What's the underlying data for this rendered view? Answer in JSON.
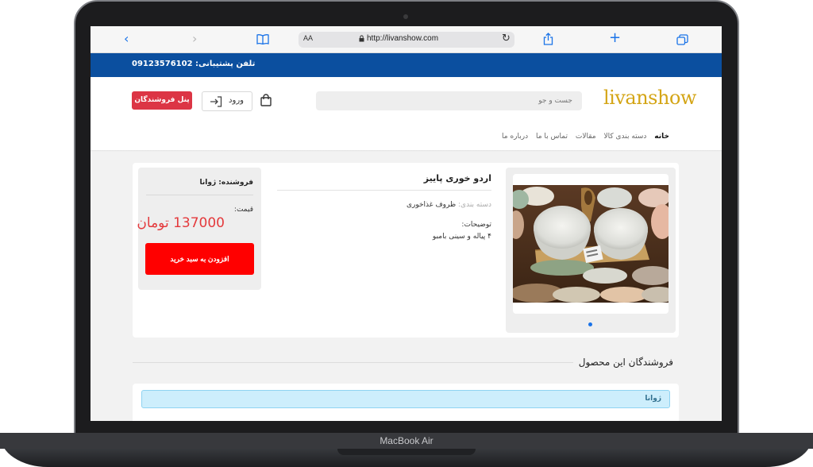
{
  "device": {
    "label": "MacBook Air"
  },
  "browser": {
    "url": "http://livanshow.com",
    "text_size": "AA",
    "icons": [
      "chevron-left-icon",
      "chevron-right-icon",
      "book-icon",
      "lock-icon",
      "reload-icon",
      "share-icon",
      "plus-icon",
      "tabs-icon"
    ]
  },
  "support": {
    "text": "تلفن پشتیبانی: 09123576102"
  },
  "header": {
    "logo": "livanshow",
    "search_placeholder": "جست و جو",
    "login_label": "ورود",
    "seller_panel_label": "پنل فروشندگان"
  },
  "nav": {
    "items": [
      {
        "label": "خانه"
      },
      {
        "label": "دسته بندی کالا"
      },
      {
        "label": "مقالات"
      },
      {
        "label": "تماس با ما"
      },
      {
        "label": "درباره ما"
      }
    ]
  },
  "product": {
    "title": "اردو خوری پاییز",
    "category_label": "دسته بندی:",
    "category_value": "ظروف غذاخوری",
    "description_label": "توضیحات:",
    "description_value": "۴ پیاله و سینی بامبو",
    "seller_line": "فروشنده: ژوانا",
    "price_label": "قیمت:",
    "price_value": "137000 تومان",
    "add_to_cart_label": "افزودن به سبد خرید"
  },
  "sellers": {
    "title": "فروشندگان این محصول",
    "items": [
      {
        "name": "ژوانا"
      }
    ]
  },
  "colors": {
    "support_bar": "#0b4f9f",
    "logo": "#d4a516",
    "seller_panel_button": "#dc3545",
    "price": "#e4393c",
    "add_to_cart": "#ff0000",
    "seller_chip": "#cdeefc"
  }
}
